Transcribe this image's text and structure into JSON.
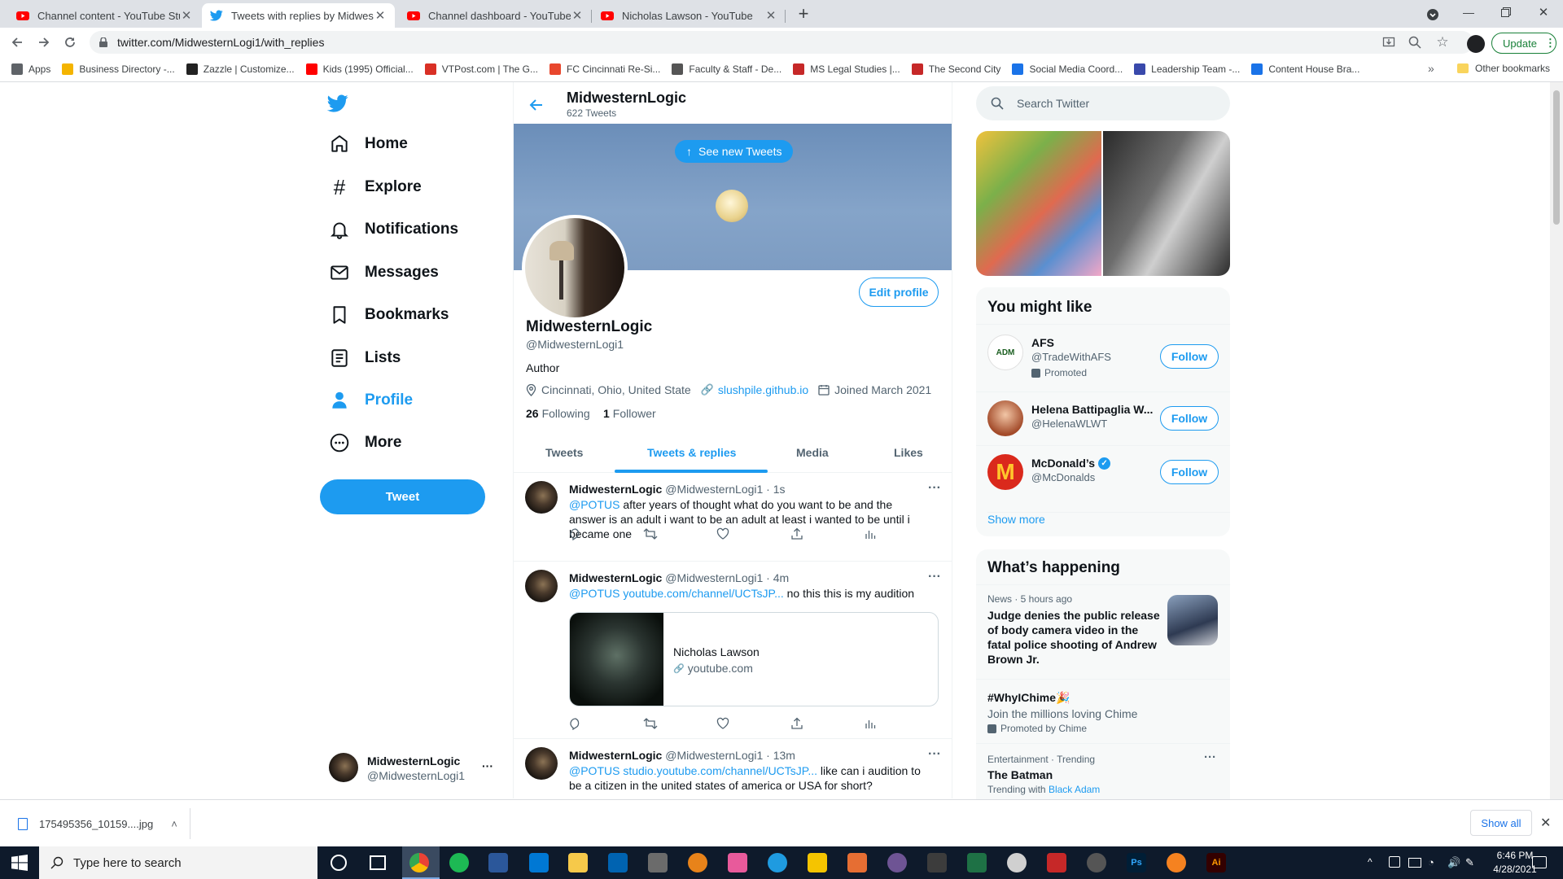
{
  "browser": {
    "tabs": [
      {
        "title": "Channel content - YouTube Studi",
        "fav": "youtube-icon",
        "color": "#ff0000"
      },
      {
        "title": "Tweets with replies by Midweste",
        "fav": "twitter-icon",
        "color": "#1d9bf0"
      },
      {
        "title": "Channel dashboard - YouTube St",
        "fav": "youtube-icon",
        "color": "#ff0000"
      },
      {
        "title": "Nicholas Lawson - YouTube",
        "fav": "youtube-icon",
        "color": "#ff0000"
      }
    ],
    "url": "twitter.com/MidwesternLogi1/with_replies",
    "update_label": "Update",
    "bookmarks": [
      {
        "label": "Apps",
        "color": "#5f6368"
      },
      {
        "label": "Business Directory -...",
        "color": "#f4b400"
      },
      {
        "label": "Zazzle | Customize...",
        "color": "#222222"
      },
      {
        "label": "Kids (1995) Official...",
        "color": "#ff0000"
      },
      {
        "label": "VTPost.com | The G...",
        "color": "#d93025"
      },
      {
        "label": "FC Cincinnati Re-Si...",
        "color": "#e8472d"
      },
      {
        "label": "Faculty & Staff - De...",
        "color": "#555555"
      },
      {
        "label": "MS Legal Studies |...",
        "color": "#c62828"
      },
      {
        "label": "The Second City",
        "color": "#c62828"
      },
      {
        "label": "Social Media Coord...",
        "color": "#1a73e8"
      },
      {
        "label": "Leadership Team -...",
        "color": "#3949ab"
      },
      {
        "label": "Content House Bra...",
        "color": "#1a73e8"
      }
    ],
    "other_bookmarks": "Other bookmarks",
    "more_bookmarks": "»"
  },
  "nav": {
    "items": [
      {
        "label": "Home",
        "icon": "home-icon"
      },
      {
        "label": "Explore",
        "icon": "hashtag-icon"
      },
      {
        "label": "Notifications",
        "icon": "bell-icon"
      },
      {
        "label": "Messages",
        "icon": "envelope-icon"
      },
      {
        "label": "Bookmarks",
        "icon": "bookmark-icon"
      },
      {
        "label": "Lists",
        "icon": "list-icon"
      },
      {
        "label": "Profile",
        "icon": "person-icon"
      },
      {
        "label": "More",
        "icon": "more-circle-icon"
      }
    ],
    "tweet_button": "Tweet",
    "account_name": "MidwesternLogic",
    "account_handle": "@MidwesternLogi1",
    "account_more": "···"
  },
  "profile": {
    "header_name": "MidwesternLogic",
    "tweet_count": "622 Tweets",
    "see_new": "See new Tweets",
    "edit_profile": "Edit profile",
    "name": "MidwesternLogic",
    "handle": "@MidwesternLogi1",
    "bio": "Author",
    "location": "Cincinnati, Ohio, United State",
    "website": "slushpile.github.io",
    "joined": "Joined March 2021",
    "following_count": "26",
    "following_label": "Following",
    "followers_count": "1",
    "followers_label": "Follower",
    "tabs": [
      "Tweets",
      "Tweets & replies",
      "Media",
      "Likes"
    ],
    "active_tab": 1
  },
  "tweets": [
    {
      "name": "MidwesternLogic",
      "meta": "@MidwesternLogi1 · 1s",
      "mention": "@POTUS",
      "text": " after years of thought what do you want to be and the answer is an adult i want to be an adult at least i wanted to be until i became one",
      "link": ""
    },
    {
      "name": "MidwesternLogic",
      "meta": "@MidwesternLogi1 · 4m",
      "mention": "@POTUS",
      "link": " youtube.com/channel/UCTsJP...",
      "text": " no this this is my audition",
      "card_title": "Nicholas Lawson",
      "card_domain": "youtube.com"
    },
    {
      "name": "MidwesternLogic",
      "meta": "@MidwesternLogi1 · 13m",
      "mention": "@POTUS",
      "link": " studio.youtube.com/channel/UCTsJP...",
      "text": " like can i audition to be a citizen in the united states of america or USA for short?"
    }
  ],
  "right": {
    "search_placeholder": "Search Twitter",
    "might_like_title": "You might like",
    "suggestions": [
      {
        "name": "AFS",
        "handle": "@TradeWithAFS",
        "promoted": "Promoted",
        "follow": "Follow"
      },
      {
        "name": "Helena Battipaglia W...",
        "handle": "@HelenaWLWT",
        "follow": "Follow"
      },
      {
        "name": "McDonald’s",
        "handle": "@McDonalds",
        "follow": "Follow"
      }
    ],
    "show_more": "Show more",
    "happening_title": "What’s happening",
    "news": {
      "meta": "News · 5 hours ago",
      "headline": "Judge denies the public release of body camera video in the fatal police shooting of Andrew Brown Jr."
    },
    "promo": {
      "tag": "#WhyIChime🎉",
      "desc": "Join the millions loving Chime",
      "by": "Promoted by Chime"
    },
    "trend": {
      "meta": "Entertainment · Trending",
      "name": "The Batman",
      "with_label": "Trending with",
      "with": "Black Adam"
    }
  },
  "downloads": {
    "file": "175495356_10159....jpg",
    "show_all": "Show all"
  },
  "taskbar": {
    "search_placeholder": "Type here to search",
    "time": "6:46 PM",
    "date": "4/28/2021"
  }
}
